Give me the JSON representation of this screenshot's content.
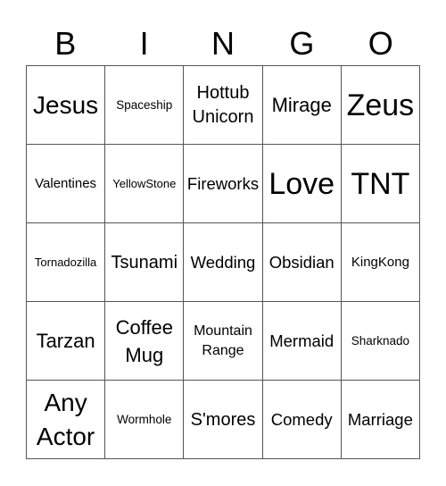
{
  "header": {
    "letters": [
      "B",
      "I",
      "N",
      "G",
      "O"
    ]
  },
  "cells": [
    [
      "Jesus",
      "Spaceship",
      "Hottub Unicorn",
      "Mirage",
      "Zeus"
    ],
    [
      "Valentines",
      "YellowStone",
      "Fireworks",
      "Love",
      "TNT"
    ],
    [
      "Tornadozilla",
      "Tsunami",
      "Wedding",
      "Obsidian",
      "KingKong"
    ],
    [
      "Tarzan",
      "Coffee Mug",
      "Mountain Range",
      "Mermaid",
      "Sharknado"
    ],
    [
      "Any Actor",
      "Wormhole",
      "S'mores",
      "Comedy",
      "Marriage"
    ]
  ]
}
